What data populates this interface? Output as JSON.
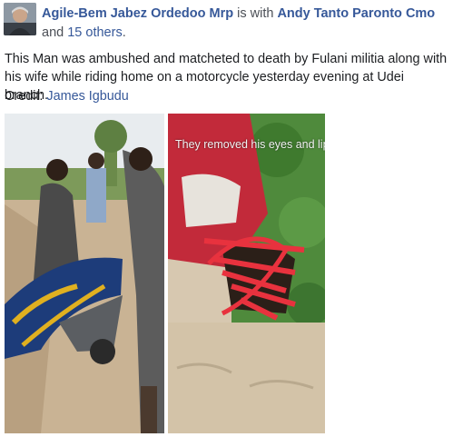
{
  "post": {
    "author": "Agile-Bem Jabez Ordedoo Mrp",
    "with_text": " is with ",
    "tagged": "Andy Tanto Paronto Cmo",
    "and_text": " and ",
    "others": "15 others",
    "period": ".",
    "body": "This Man was ambushed and matcheted to death by Fulani militia along with his wife while riding home on a motorcycle yesterday evening at Udei branch.",
    "credit_label": "Credit:",
    "credit_name": "James Igbudu"
  },
  "photos": {
    "right_overlay": "They removed his eyes and lip"
  },
  "colors": {
    "link": "#365899",
    "text": "#1c1e21",
    "secondary": "#4b4f56"
  }
}
